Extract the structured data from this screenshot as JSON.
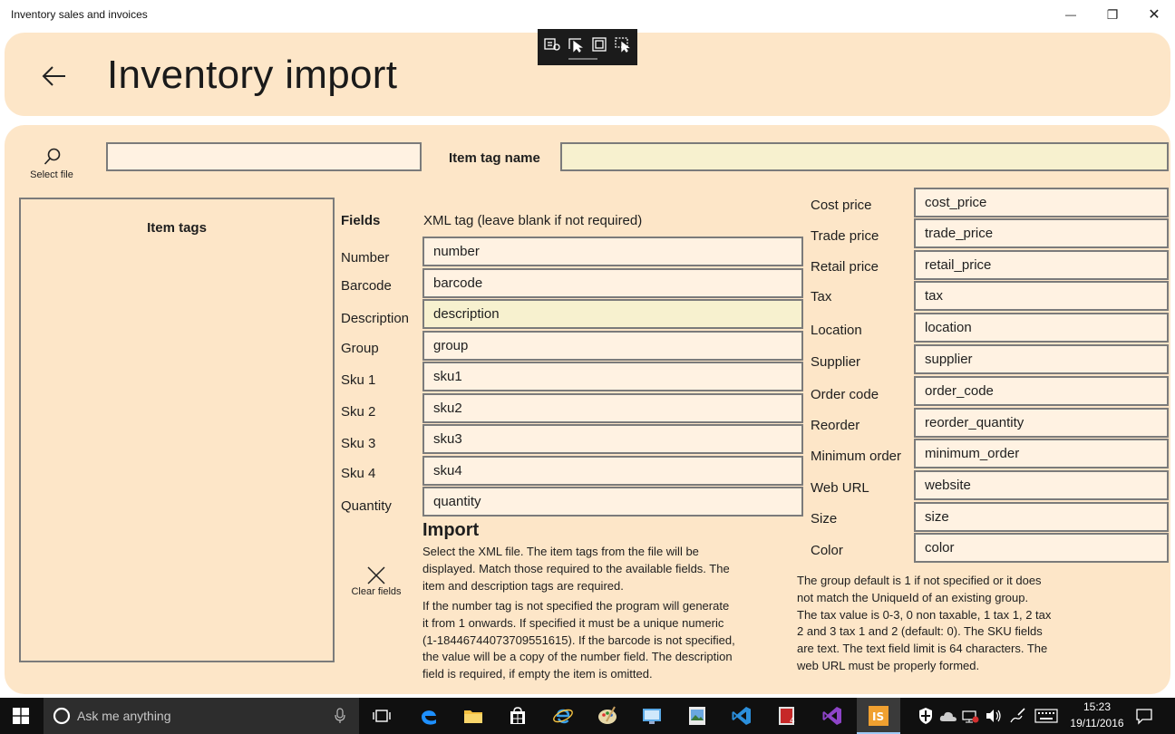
{
  "window": {
    "title": "Inventory sales and invoices",
    "minimize": "—",
    "restore": "❐",
    "close": "✕"
  },
  "header": {
    "title": "Inventory import"
  },
  "file": {
    "select_label": "Select file",
    "path_value": "",
    "item_tag_label": "Item tag name",
    "item_tag_value": ""
  },
  "tags_panel": {
    "title": "Item tags"
  },
  "fields": {
    "header_fields": "Fields",
    "header_xml": "XML tag (leave blank if not required)",
    "left": [
      {
        "label": "Number",
        "value": "number"
      },
      {
        "label": "Barcode",
        "value": "barcode"
      },
      {
        "label": "Description",
        "value": "description"
      },
      {
        "label": "Group",
        "value": "group"
      },
      {
        "label": "Sku 1",
        "value": "sku1"
      },
      {
        "label": "Sku 2",
        "value": "sku2"
      },
      {
        "label": "Sku 3",
        "value": "sku3"
      },
      {
        "label": "Sku 4",
        "value": "sku4"
      },
      {
        "label": "Quantity",
        "value": "quantity"
      }
    ],
    "right": [
      {
        "label": "Cost price",
        "value": "cost_price"
      },
      {
        "label": "Trade price",
        "value": "trade_price"
      },
      {
        "label": "Retail price",
        "value": "retail_price"
      },
      {
        "label": "Tax",
        "value": "tax"
      },
      {
        "label": "Location",
        "value": "location"
      },
      {
        "label": "Supplier",
        "value": "supplier"
      },
      {
        "label": "Order code",
        "value": "order_code"
      },
      {
        "label": "Reorder",
        "value": "reorder_quantity"
      },
      {
        "label": "Minimum order",
        "value": "minimum_order"
      },
      {
        "label": "Web URL",
        "value": "website"
      },
      {
        "label": "Size",
        "value": "size"
      },
      {
        "label": "Color",
        "value": "color"
      }
    ]
  },
  "clear": {
    "label": "Clear fields"
  },
  "import": {
    "title": "Import",
    "para1": [
      "Select the XML file. The item tags from the file will be",
      "displayed. Match those required to the available fields. The",
      "item and description tags are required."
    ],
    "para2": [
      "If the number tag is not specified the program will generate",
      "it from 1 onwards. If specified it must be a unique numeric",
      "(1-18446744073709551615).  If the barcode is not specified,",
      "the value will be a copy of the number field. The description",
      "field is required, if empty the item is omitted."
    ],
    "para3": [
      "The group default is 1 if not specified or it does",
      "not match the UniqueId of an existing group.",
      "The tax value is 0-3, 0 non taxable, 1 tax 1, 2 tax",
      "2 and 3 tax 1 and 2 (default: 0). The SKU fields",
      "are text. The text field limit is 64 characters. The",
      "web URL must be properly formed."
    ]
  },
  "taskbar": {
    "search_placeholder": "Ask me anything",
    "time": "15:23",
    "date": "19/11/2016"
  },
  "colors": {
    "panel": "#fde6c8",
    "input": "#fff2e2",
    "input_highlight": "#f7f1cf",
    "border": "#7b7b7b"
  }
}
